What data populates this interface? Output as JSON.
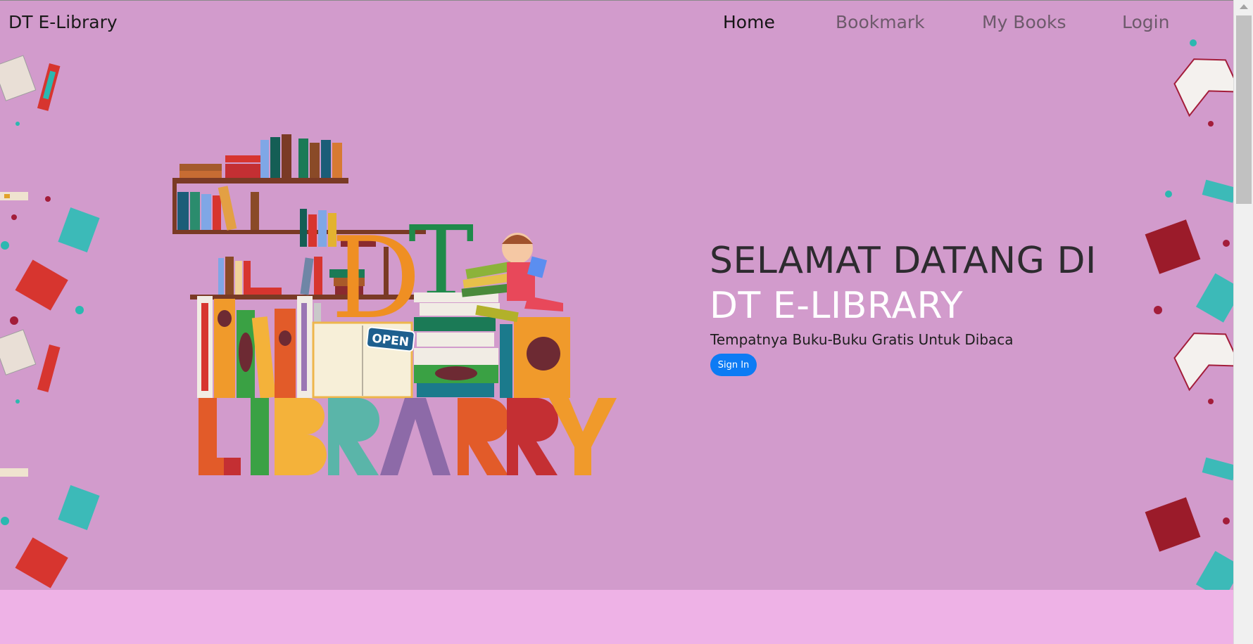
{
  "navbar": {
    "brand": "DT E-Library",
    "items": [
      {
        "label": "Home",
        "active": true
      },
      {
        "label": "Bookmark",
        "active": false
      },
      {
        "label": "My Books",
        "active": false
      },
      {
        "label": "Login",
        "active": false
      }
    ]
  },
  "hero": {
    "title_line1": "SELAMAT DATANG DI",
    "title_line2": "DT E-LIBRARY",
    "subtitle": "Tempatnya Buku-Buku Gratis Untuk Dibaca",
    "signin_label": "Sign In"
  },
  "illustration": {
    "logo_letters_top": "DT",
    "logo_word": "LIBRARY",
    "sign_text": "OPEN"
  },
  "colors": {
    "hero_background": "#d29bcc",
    "page_background": "#eeb2e6",
    "button": "#0d7bf4",
    "title_dark": "#2d2b2f",
    "title_light": "#ffffff"
  }
}
